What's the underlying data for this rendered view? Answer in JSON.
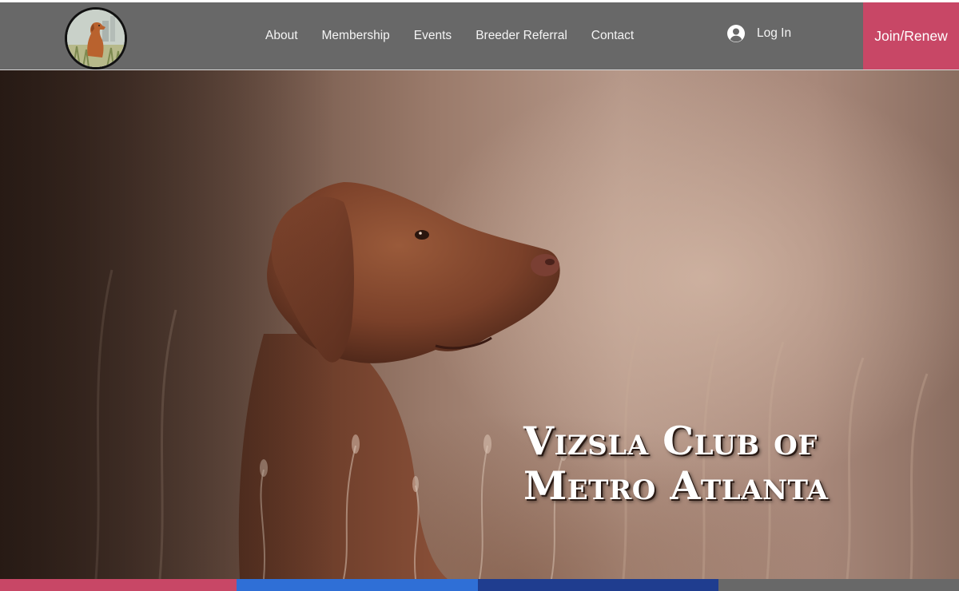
{
  "header": {
    "logo_icon": "vizsla-dog-logo-icon",
    "nav": [
      {
        "label": "About"
      },
      {
        "label": "Membership"
      },
      {
        "label": "Events"
      },
      {
        "label": "Breeder Referral"
      },
      {
        "label": "Contact"
      }
    ],
    "login": {
      "label": "Log In",
      "icon": "user-avatar-icon"
    },
    "join_label": "Join/Renew"
  },
  "hero": {
    "title_line1": "Vizsla Club of",
    "title_line2": "Metro Atlanta",
    "image": "vizsla-dog-in-field-photo"
  },
  "colors": {
    "header_bg": "#686868",
    "join_bg": "#c84766",
    "bar_segments": [
      "#c84766",
      "#2f6fd6",
      "#1f3d8f",
      "#686868"
    ]
  }
}
